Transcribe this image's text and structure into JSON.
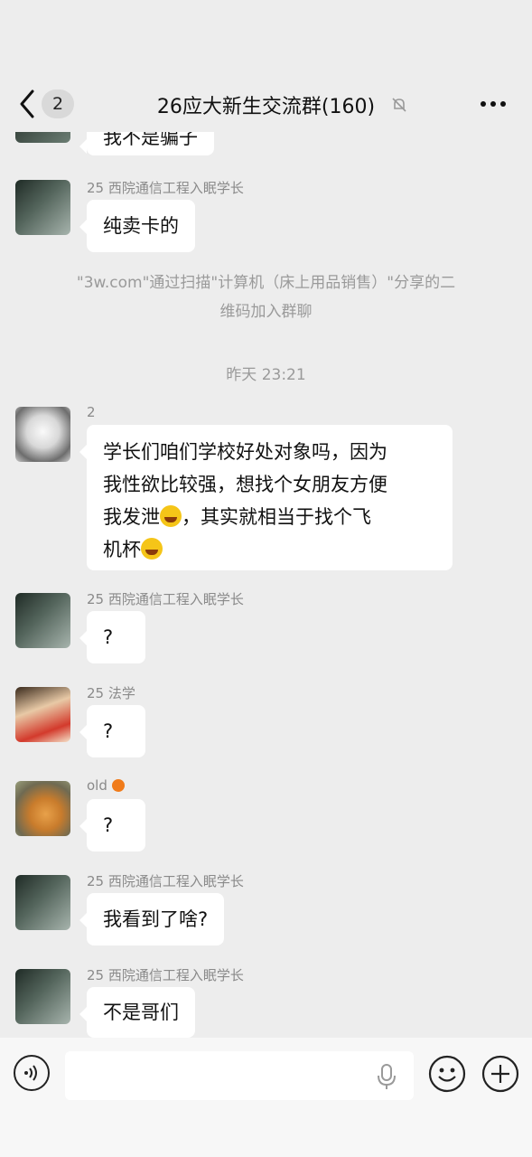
{
  "header": {
    "back_count": "2",
    "title": "26应大新生交流群(160)"
  },
  "messages": {
    "top_partial": "我不是骗子",
    "m1": {
      "sender": "25 西院通信工程入眠学长",
      "text": "纯卖卡的"
    },
    "system_notice_line1": "\"3w.com\"通过扫描\"计算机（床上用品销售）\"分享的二",
    "system_notice_line2": "维码加入群聊",
    "timestamp": "昨天 23:21",
    "m2": {
      "sender": "2",
      "line1": "学长们咱们学校好处对象吗，因为",
      "line2": "我性欲比较强，想找个女朋友方便",
      "line3a": "我发泄",
      "line3b": "，其实就相当于找个飞",
      "line4": "机杯"
    },
    "m3": {
      "sender": "25 西院通信工程入眠学长",
      "text": "?"
    },
    "m4": {
      "sender": "25 法学",
      "text": "?"
    },
    "m5": {
      "sender": "old",
      "text": "?"
    },
    "m6": {
      "sender": "25 西院通信工程入眠学长",
      "text": "我看到了啥?"
    },
    "m7": {
      "sender": "25 西院通信工程入眠学长",
      "text": "不是哥们"
    }
  },
  "icons": {
    "back": "chevron-left-icon",
    "mute": "bell-off-icon",
    "more": "more-dots-icon",
    "voice": "voice-icon",
    "mic": "microphone-icon",
    "emoji": "smiley-icon",
    "plus": "plus-icon"
  },
  "colors": {
    "background": "#ededed",
    "bubble": "#ffffff",
    "meta_text": "#9a9a9a"
  }
}
